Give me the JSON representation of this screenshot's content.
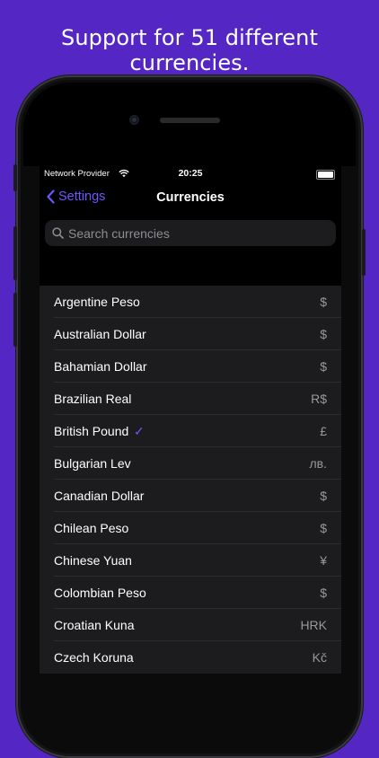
{
  "headline": "Support for 51 different currencies.",
  "status_bar": {
    "carrier": "Network Provider",
    "time": "20:25"
  },
  "nav": {
    "back_label": "Settings",
    "title": "Currencies"
  },
  "search": {
    "placeholder": "Search currencies",
    "value": ""
  },
  "colors": {
    "background": "#5427c4",
    "accent": "#6f56ff",
    "cell": "#1c1c1e",
    "secondary_text": "#98989d"
  },
  "currencies": [
    {
      "name": "Argentine Peso",
      "symbol": "$",
      "selected": false
    },
    {
      "name": "Australian Dollar",
      "symbol": "$",
      "selected": false
    },
    {
      "name": "Bahamian Dollar",
      "symbol": "$",
      "selected": false
    },
    {
      "name": "Brazilian Real",
      "symbol": "R$",
      "selected": false
    },
    {
      "name": "British Pound",
      "symbol": "£",
      "selected": true,
      "check": "✓"
    },
    {
      "name": "Bulgarian Lev",
      "symbol": "лв.",
      "selected": false
    },
    {
      "name": "Canadian Dollar",
      "symbol": "$",
      "selected": false
    },
    {
      "name": "Chilean Peso",
      "symbol": "$",
      "selected": false
    },
    {
      "name": "Chinese Yuan",
      "symbol": "¥",
      "selected": false
    },
    {
      "name": "Colombian Peso",
      "symbol": "$",
      "selected": false
    },
    {
      "name": "Croatian Kuna",
      "symbol": "HRK",
      "selected": false
    },
    {
      "name": "Czech Koruna",
      "symbol": "Kč",
      "selected": false
    }
  ]
}
